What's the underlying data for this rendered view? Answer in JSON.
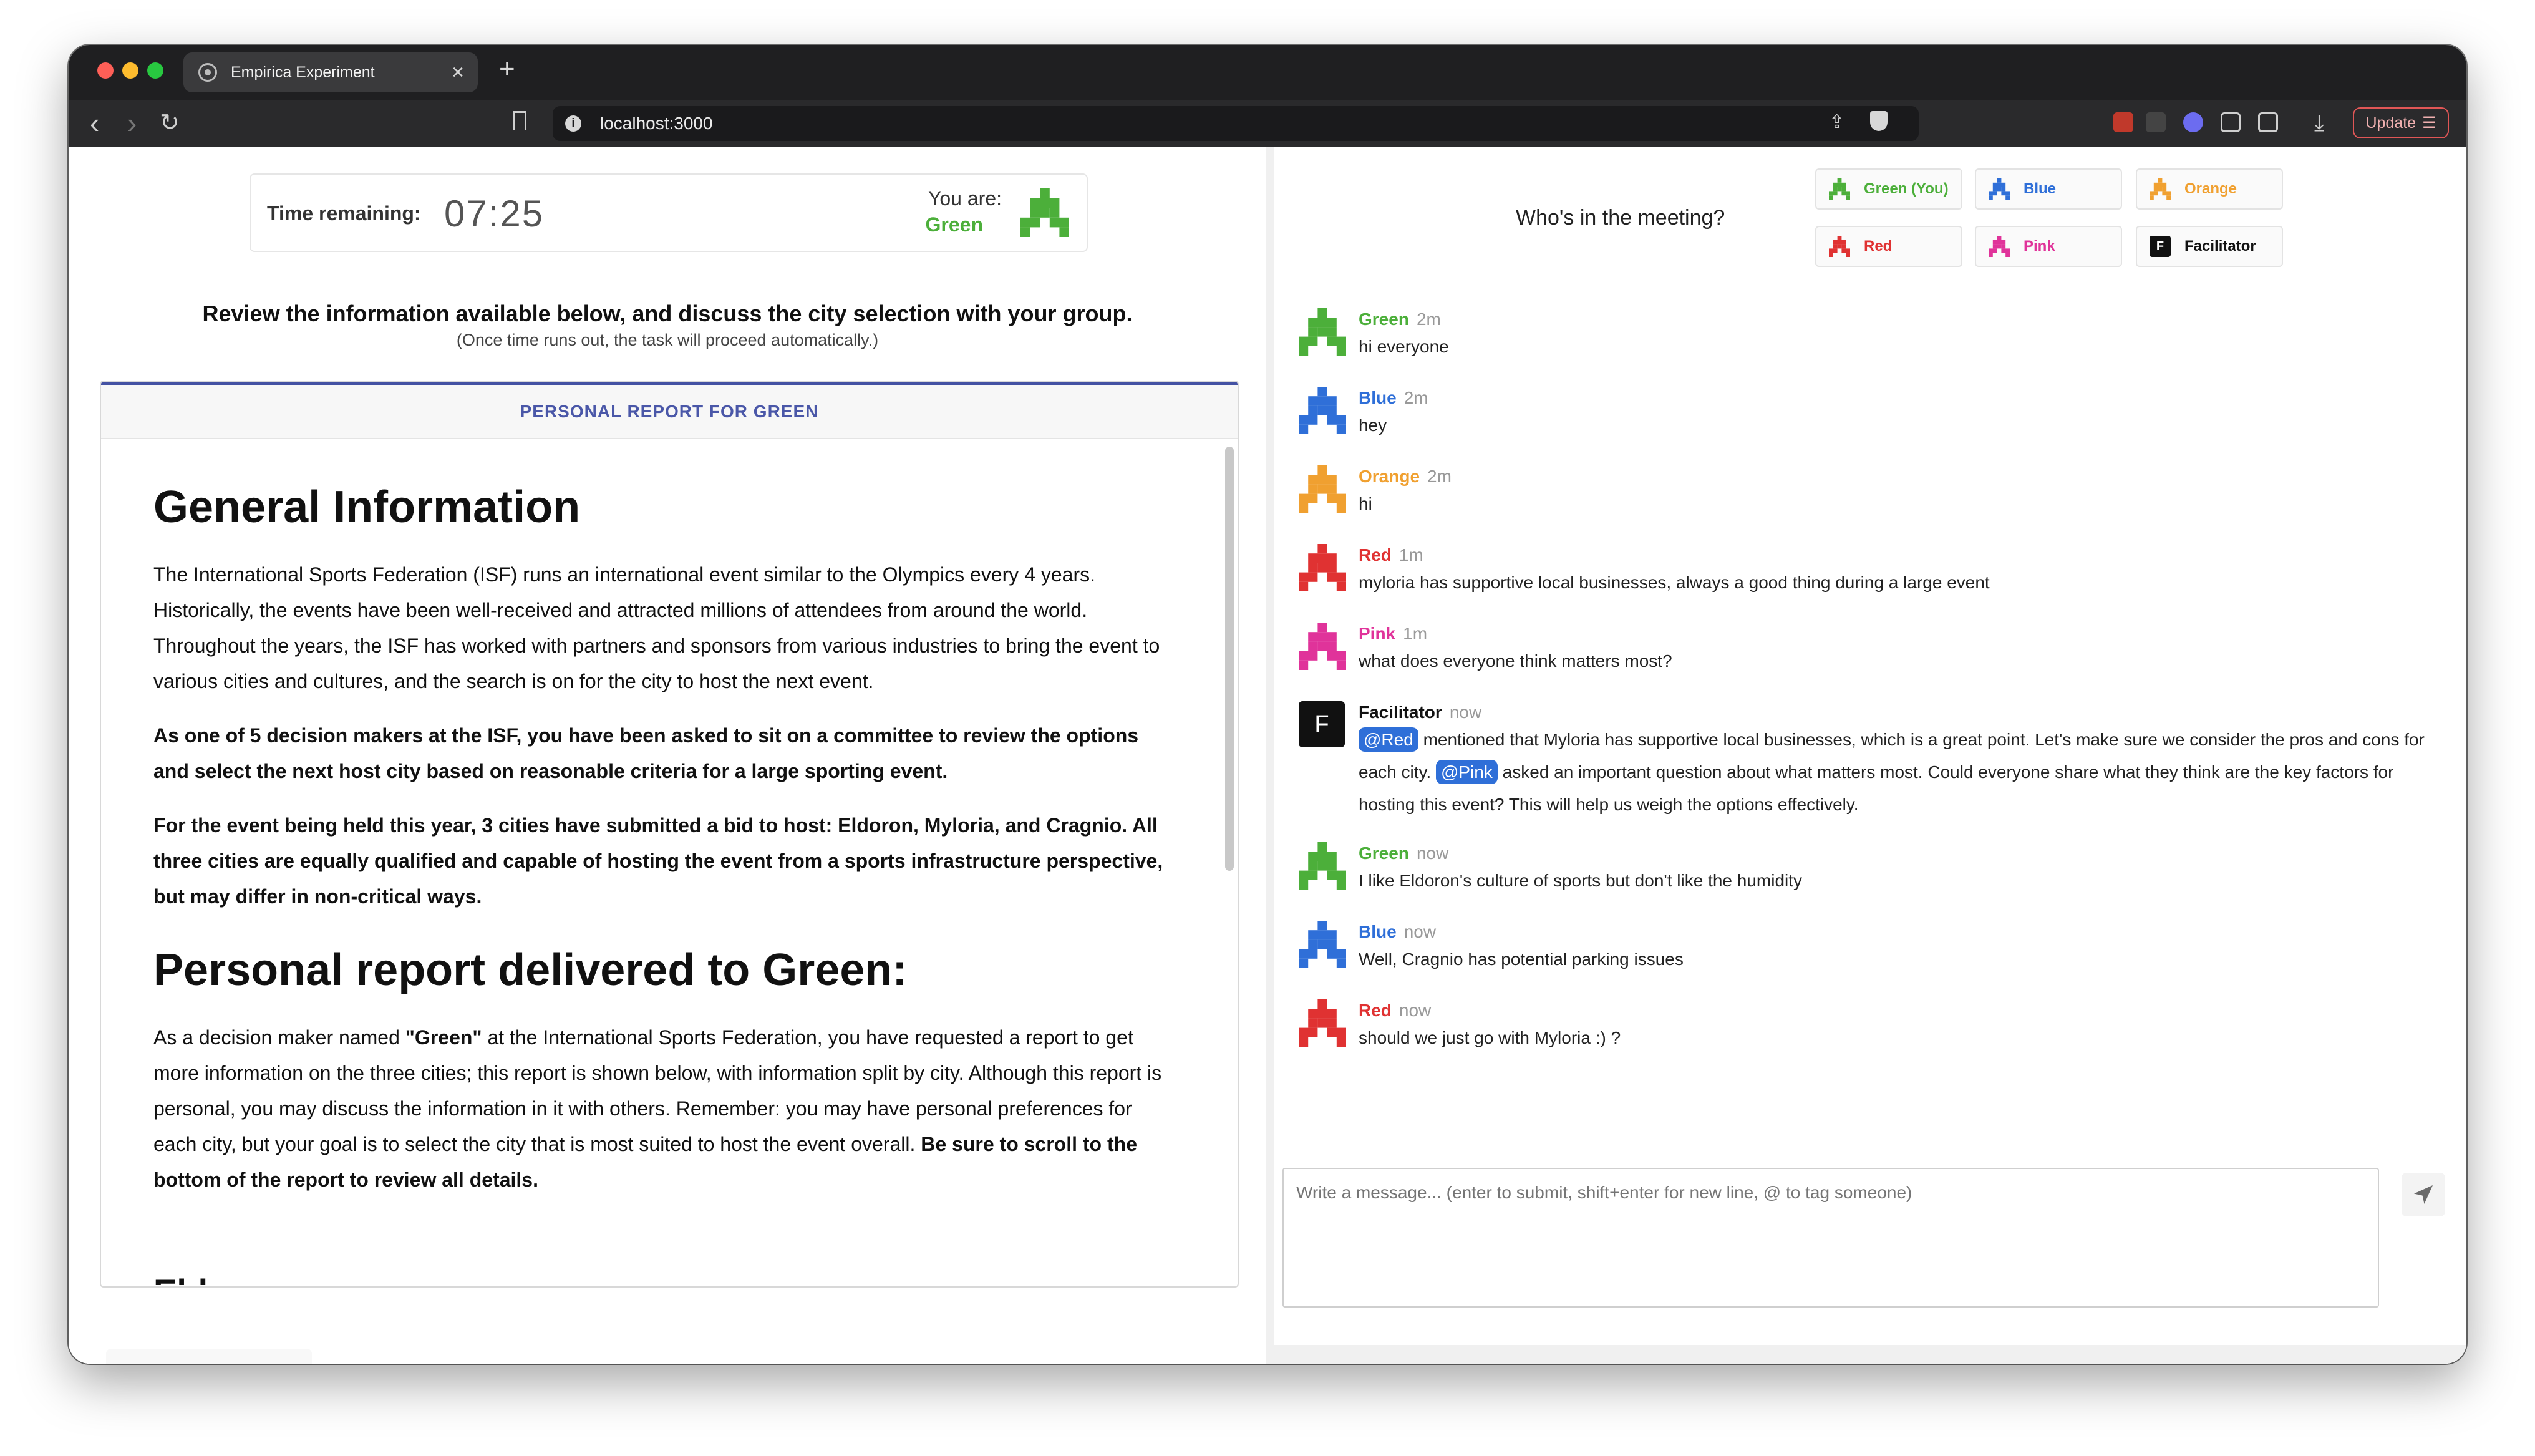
{
  "browser": {
    "tab_title": "Empirica Experiment",
    "tab_close": "×",
    "new_tab": "+",
    "url": "localhost:3000",
    "update_label": "Update"
  },
  "timer": {
    "label": "Time remaining:",
    "value": "07:25",
    "you_are_label": "You are:",
    "you_are_name": "Green",
    "you_are_color": "#4caf3a"
  },
  "instructions": {
    "main": "Review the information available below, and discuss the city selection with your group.",
    "sub": "(Once time runs out, the task will proceed automatically.)"
  },
  "report": {
    "header": "PERSONAL REPORT FOR GREEN",
    "heading_general": "General Information",
    "para1": "The International Sports Federation (ISF) runs an international event similar to the Olympics every 4 years. Historically, the events have been well-received and attracted millions of attendees from around the world. Throughout the years, the ISF has worked with partners and sponsors from various industries to bring the event to various cities and cultures, and the search is on for the city to host the next event.",
    "para2": "As one of 5 decision makers at the ISF, you have been asked to sit on a committee to review the options and select the next host city based on reasonable criteria for a large sporting event.",
    "para3": "For the event being held this year, 3 cities have submitted a bid to host: Eldoron, Myloria, and Cragnio. All three cities are equally qualified and capable of hosting the event from a sports infrastructure perspective, but may differ in non-critical ways.",
    "heading_personal": "Personal report delivered to Green:",
    "para4_a": "As a decision maker named ",
    "para4_name": "\"Green\"",
    "para4_b": " at the International Sports Federation, you have requested a report to get more information on the three cities; this report is shown below, with information split by city. Although this report is personal, you may discuss the information in it with others. Remember: you may have personal preferences for each city, but your goal is to select the city that is most suited to host the event overall. ",
    "para4_bold": "Be sure to scroll to the bottom of the report to review all details.",
    "heading_city": "Eldoron"
  },
  "meeting": {
    "label": "Who's in the meeting?",
    "participants": [
      {
        "label": "Green (You)",
        "color": "#4caf3a"
      },
      {
        "label": "Blue",
        "color": "#2f6fd8"
      },
      {
        "label": "Orange",
        "color": "#f0a030"
      },
      {
        "label": "Red",
        "color": "#e03232"
      },
      {
        "label": "Pink",
        "color": "#e0339a"
      },
      {
        "label": "Facilitator",
        "color": "#111111",
        "icon_letter": "F"
      }
    ]
  },
  "chat": {
    "messages": [
      {
        "name": "Green",
        "time": "2m",
        "text": "hi everyone",
        "color": "#4caf3a"
      },
      {
        "name": "Blue",
        "time": "2m",
        "text": "hey",
        "color": "#2f6fd8"
      },
      {
        "name": "Orange",
        "time": "2m",
        "text": "hi",
        "color": "#f0a030"
      },
      {
        "name": "Red",
        "time": "1m",
        "text": "myloria has supportive local businesses, always a good thing during a large event",
        "color": "#e03232"
      },
      {
        "name": "Pink",
        "time": "1m",
        "text": "what does everyone think matters most?",
        "color": "#e0339a"
      },
      {
        "name": "Facilitator",
        "time": "now",
        "avatar_letter": "F",
        "mention1": "@Red",
        "text_a": " mentioned that Myloria has supportive local businesses, which is a great point. Let's make sure we consider the pros and cons for each city. ",
        "mention2": "@Pink",
        "text_b": " asked an important question about what matters most. Could everyone share what they think are the key factors for hosting this event? This will help us weigh the options effectively.",
        "color": "#111111"
      },
      {
        "name": "Green",
        "time": "now",
        "text": "I like Eldoron's culture of sports but don't like the humidity",
        "color": "#4caf3a"
      },
      {
        "name": "Blue",
        "time": "now",
        "text": "Well, Cragnio has potential parking issues",
        "color": "#2f6fd8"
      },
      {
        "name": "Red",
        "time": "now",
        "text": "should we just go with Myloria :) ?",
        "color": "#e03232"
      }
    ],
    "input_placeholder": "Write a message... (enter to submit, shift+enter for new line, @ to tag someone)"
  }
}
